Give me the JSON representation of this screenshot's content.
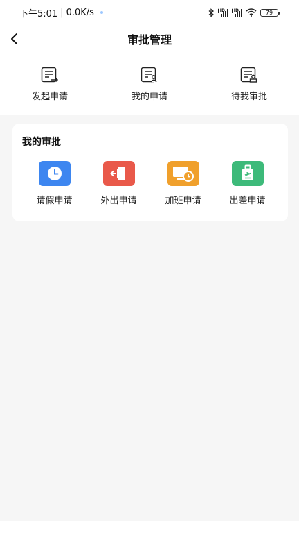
{
  "status_bar": {
    "time": "下午5:01",
    "speed": "0.0K/s",
    "separator": "|",
    "battery": "79",
    "hd1": "HD",
    "hd2": "HD"
  },
  "header": {
    "title": "审批管理"
  },
  "quick_actions": [
    {
      "label": "发起申请",
      "icon": "document-arrow-icon"
    },
    {
      "label": "我的申请",
      "icon": "document-user-icon"
    },
    {
      "label": "待我审批",
      "icon": "document-stamp-icon"
    }
  ],
  "approvals": {
    "title": "我的审批",
    "items": [
      {
        "label": "请假申请",
        "icon": "clock-icon",
        "color": "#3d86f0"
      },
      {
        "label": "外出申请",
        "icon": "exit-door-icon",
        "color": "#e9594a"
      },
      {
        "label": "加班申请",
        "icon": "monitor-clock-icon",
        "color": "#f0a02c"
      },
      {
        "label": "出差申请",
        "icon": "luggage-icon",
        "color": "#3dba7a"
      }
    ]
  }
}
